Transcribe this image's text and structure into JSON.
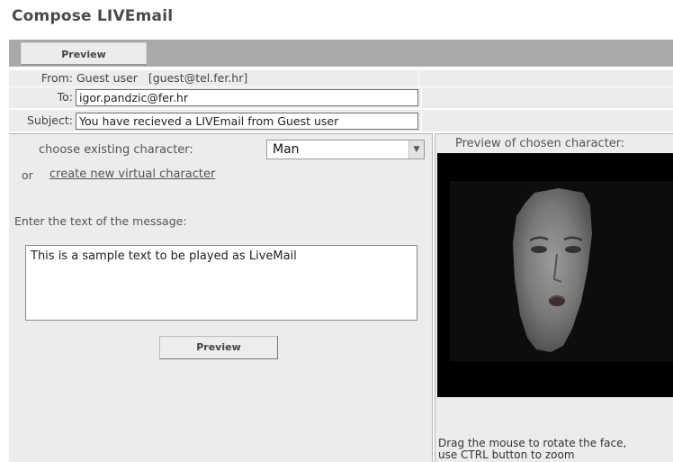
{
  "page": {
    "title": "Compose LIVEmail"
  },
  "toolbar": {
    "preview_label": "Preview"
  },
  "header": {
    "from_label": "From:",
    "from_value": "Guest user   [guest@tel.fer.hr]",
    "to_label": "To:",
    "to_value": "igor.pandzic@fer.hr",
    "subject_label": "Subject:",
    "subject_value": "You have recieved a LIVEmail from Guest user"
  },
  "left_panel": {
    "choose_label": "choose existing character:",
    "character_selected": "Man",
    "or_label": "or",
    "create_link": "create new virtual character",
    "message_label": "Enter the text of the message:",
    "message_value": "This is a sample text to be played as LiveMail",
    "preview_button": "Preview"
  },
  "right_panel": {
    "title": "Preview of chosen character:",
    "caption_line1": "Drag the mouse to rotate the face,",
    "caption_line2": "use CTRL button to zoom"
  },
  "colors": {
    "toolbar": "#a9a9a9",
    "panel": "#ececec",
    "preview_bg": "#000000"
  }
}
